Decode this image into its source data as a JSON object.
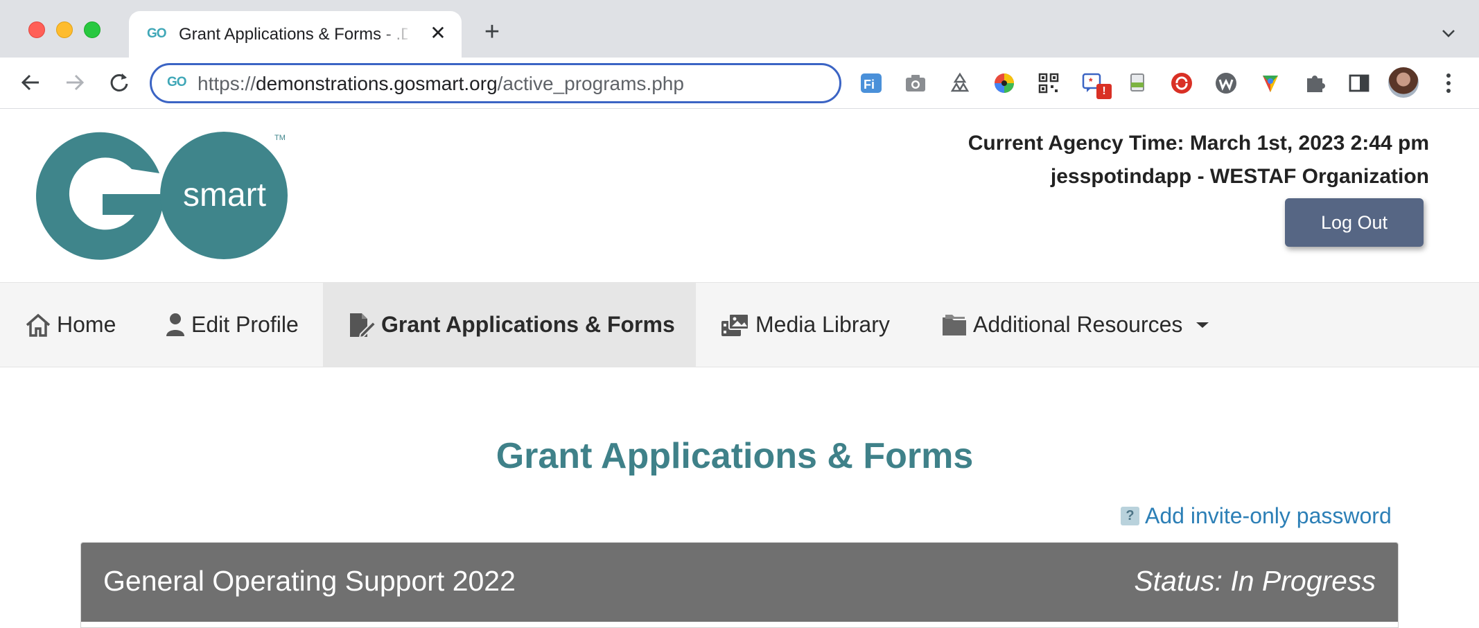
{
  "browser": {
    "tab_title": "Grant Applications & Forms - .D",
    "tab_favicon_text": "GO",
    "url_scheme": "https://",
    "url_host": "demonstrations.gosmart.org",
    "url_path": "/active_programs.php",
    "extensions": [
      "fi-translator-icon",
      "camera-icon",
      "recycle-icon",
      "color-wheel-icon",
      "qr-code-icon",
      "alert-extension-icon",
      "file-extension-icon",
      "redirect-extension-icon",
      "wappalyzer-icon",
      "multicolor-extension-icon",
      "puzzle-piece-icon",
      "side-panel-icon"
    ],
    "extension_alert_badge": "!"
  },
  "header": {
    "logo_text": "smart",
    "logo_letter": "G",
    "logo_tm": "TM",
    "agency_time": "Current Agency Time: March 1st, 2023 2:44 pm",
    "org_line": "jesspotindapp - WESTAF Organization",
    "logout_label": "Log Out"
  },
  "nav": {
    "items": [
      {
        "label": "Home",
        "icon": "home-icon"
      },
      {
        "label": "Edit Profile",
        "icon": "user-icon"
      },
      {
        "label": "Grant Applications & Forms",
        "icon": "file-edit-icon",
        "active": true
      },
      {
        "label": "Media Library",
        "icon": "media-icon"
      },
      {
        "label": "Additional Resources",
        "icon": "folder-icon",
        "dropdown": true
      }
    ]
  },
  "main": {
    "page_title": "Grant Applications & Forms",
    "help_badge": "?",
    "invite_link": "Add invite-only password",
    "program": {
      "name": "General Operating Support 2022",
      "status": "Status: In Progress"
    }
  },
  "colors": {
    "accent_teal": "#3f8189",
    "logout_button": "#566684",
    "link_blue": "#2c7fb6",
    "card_header": "#707070"
  }
}
